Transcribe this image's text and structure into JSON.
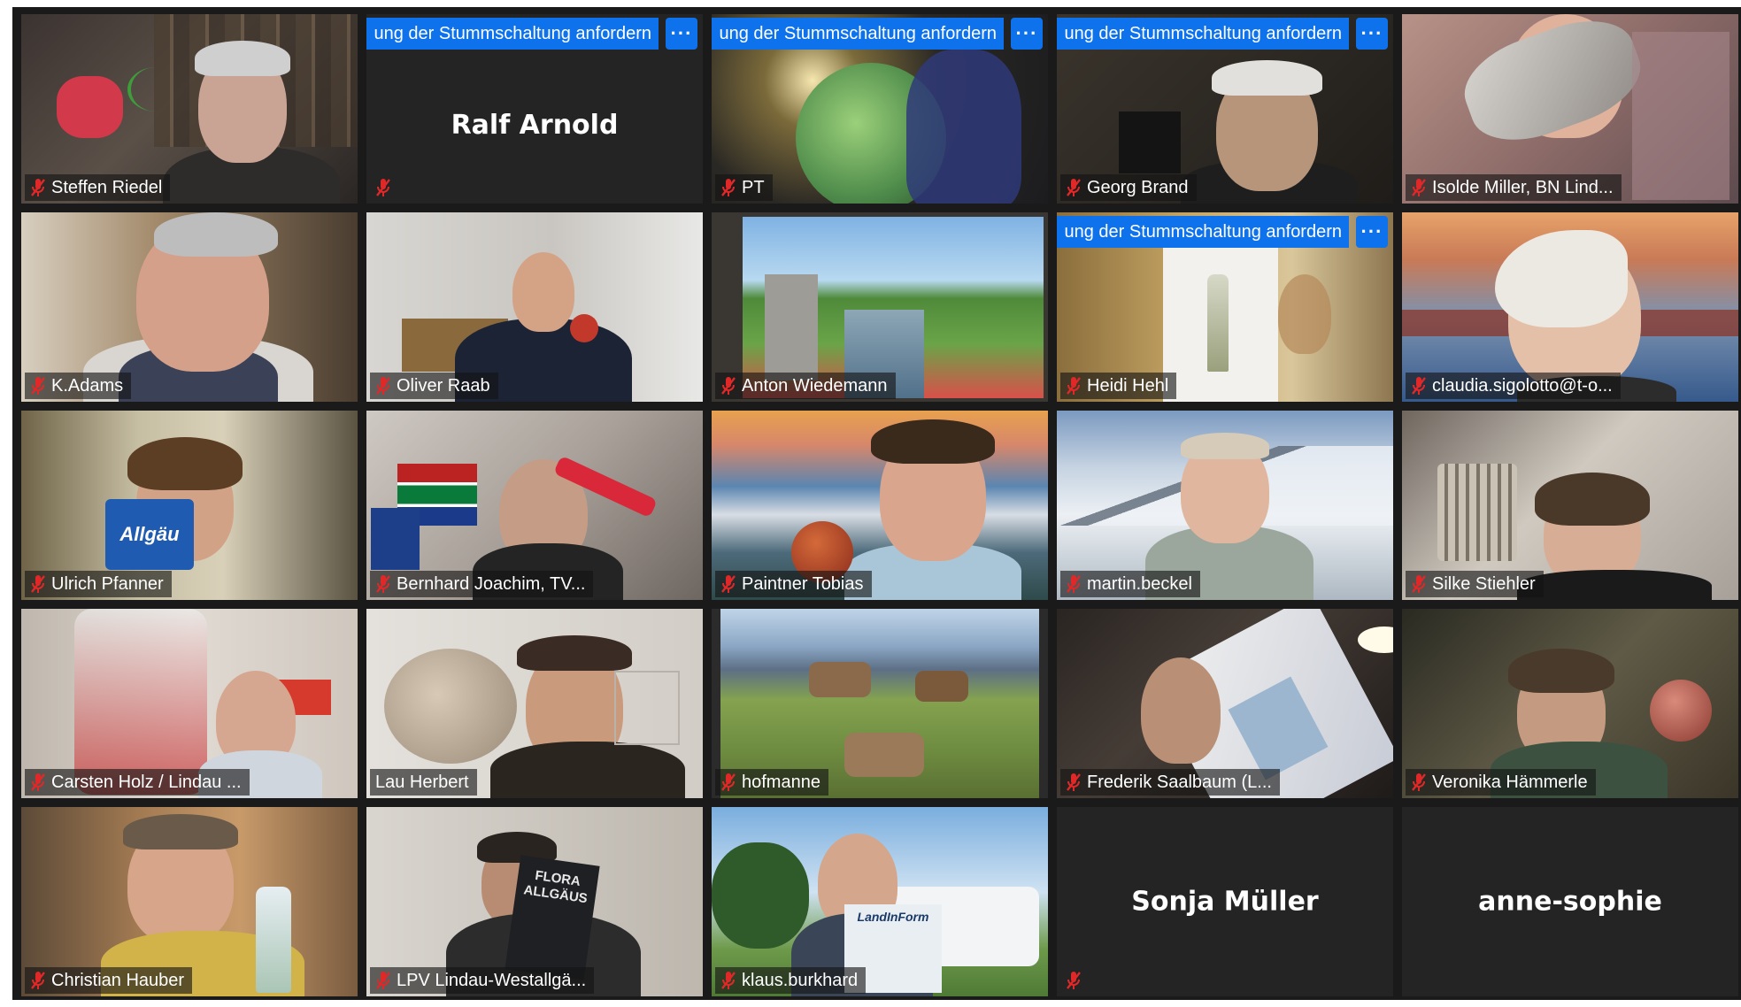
{
  "banner_text": "ung der Stummschaltung anfordern",
  "more_glyph": "···",
  "muted_icon": "muted-mic-icon",
  "colors": {
    "accent": "#0e72ed",
    "muted_red": "#e02828",
    "gallery_bg": "#1a1a1a",
    "tile_bg": "#242424"
  },
  "participants": [
    {
      "name": "Steffen Riedel",
      "muted": true
    },
    {
      "name": "Ralf Arnold",
      "muted": true,
      "video_off": true,
      "banner": true
    },
    {
      "name": "PT",
      "muted": true,
      "banner": true
    },
    {
      "name": "Georg Brand",
      "muted": true,
      "banner": true
    },
    {
      "name": "Isolde Miller, BN Lind...",
      "muted": true
    },
    {
      "name": "K.Adams",
      "muted": true
    },
    {
      "name": "Oliver Raab",
      "muted": true
    },
    {
      "name": "Anton Wiedemann",
      "muted": true
    },
    {
      "name": "Heidi Hehl",
      "muted": true,
      "banner": true
    },
    {
      "name": "claudia.sigolotto@t-o...",
      "muted": true
    },
    {
      "name": "Ulrich Pfanner",
      "muted": true
    },
    {
      "name": "Bernhard Joachim, TV...",
      "muted": true
    },
    {
      "name": "Paintner Tobias",
      "muted": true
    },
    {
      "name": "martin.beckel",
      "muted": true
    },
    {
      "name": "Silke Stiehler",
      "muted": true
    },
    {
      "name": "Carsten Holz / Lindau ...",
      "muted": true
    },
    {
      "name": "Lau Herbert",
      "muted": false
    },
    {
      "name": "hofmanne",
      "muted": true
    },
    {
      "name": "Frederik Saalbaum (L...",
      "muted": true
    },
    {
      "name": "Veronika Hämmerle",
      "muted": true
    },
    {
      "name": "Christian Hauber",
      "muted": true
    },
    {
      "name": "LPV Lindau-Westallgä...",
      "muted": true
    },
    {
      "name": "klaus.burkhard",
      "muted": true
    },
    {
      "name": "Sonja Müller",
      "muted": true,
      "video_off": true
    },
    {
      "name": "anne-sophie",
      "muted": false,
      "video_off": true
    }
  ],
  "props": {
    "allgaeu_sign": "Allgäu",
    "flora_book": "FLORA ALLGÄUS",
    "landinform_magazine": "LandInForm"
  }
}
